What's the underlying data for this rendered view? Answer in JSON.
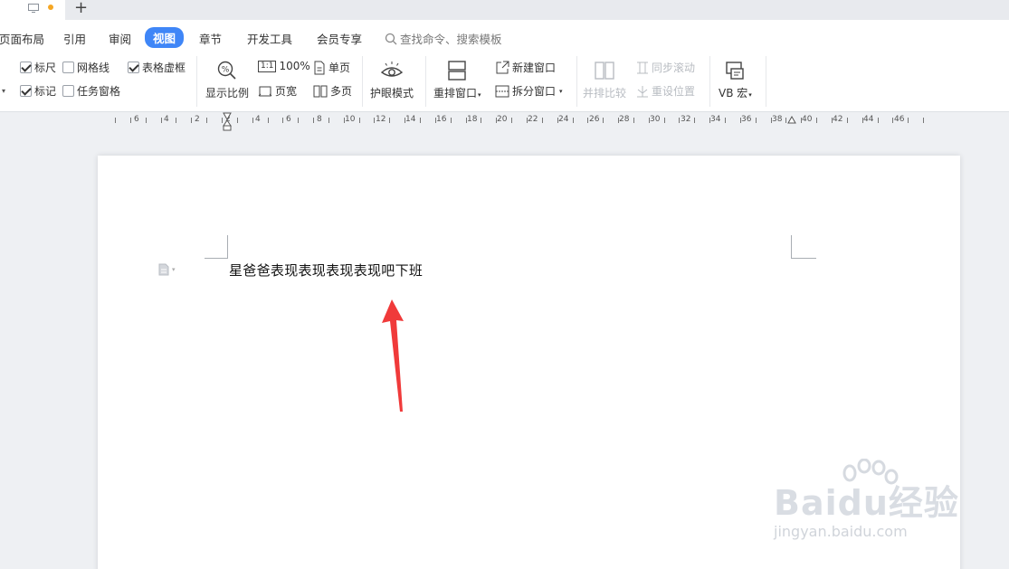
{
  "tabs": {
    "new_tab_symbol": "+"
  },
  "menu": {
    "items": [
      "页面布局",
      "引用",
      "审阅",
      "视图",
      "章节",
      "开发工具",
      "会员专享"
    ],
    "active": "视图",
    "search_label": "查找命令、搜索模板"
  },
  "ribbon": {
    "checks": {
      "ruler": {
        "label": "标尺",
        "checked": true
      },
      "gridlines": {
        "label": "网格线",
        "checked": false
      },
      "table_gridlines": {
        "label": "表格虚框",
        "checked": true
      },
      "markup": {
        "label": "标记",
        "checked": true
      },
      "task_pane": {
        "label": "任务窗格",
        "checked": false
      }
    },
    "zoom_label": "显示比例",
    "one_to_one": "1:1",
    "hundred": "100%",
    "page_width": "页宽",
    "single_page": "单页",
    "multi_page": "多页",
    "eye_mode": "护眼模式",
    "arrange": "重排窗口",
    "new_window": "新建窗口",
    "split_window": "拆分窗口",
    "side_by_side": "并排比较",
    "sync_scroll": "同步滚动",
    "reset_position": "重设位置",
    "vb_macro": "VB 宏"
  },
  "ruler": {
    "labels": [
      "6",
      "4",
      "2",
      "2",
      "4",
      "6",
      "8",
      "10",
      "12",
      "14",
      "16",
      "18",
      "20",
      "22",
      "24",
      "26",
      "28",
      "30",
      "32",
      "34",
      "36",
      "38",
      "40",
      "42",
      "44",
      "46"
    ]
  },
  "document": {
    "text": "星爸爸表现表现表现表现吧下班"
  },
  "watermark": {
    "logo_text": "Baidu经验",
    "url": "jingyan.baidu.com"
  },
  "colors": {
    "accent": "#3f86f7",
    "arrow": "#f03a3a",
    "page": "#ffffff",
    "workspace": "#eef0f3"
  }
}
